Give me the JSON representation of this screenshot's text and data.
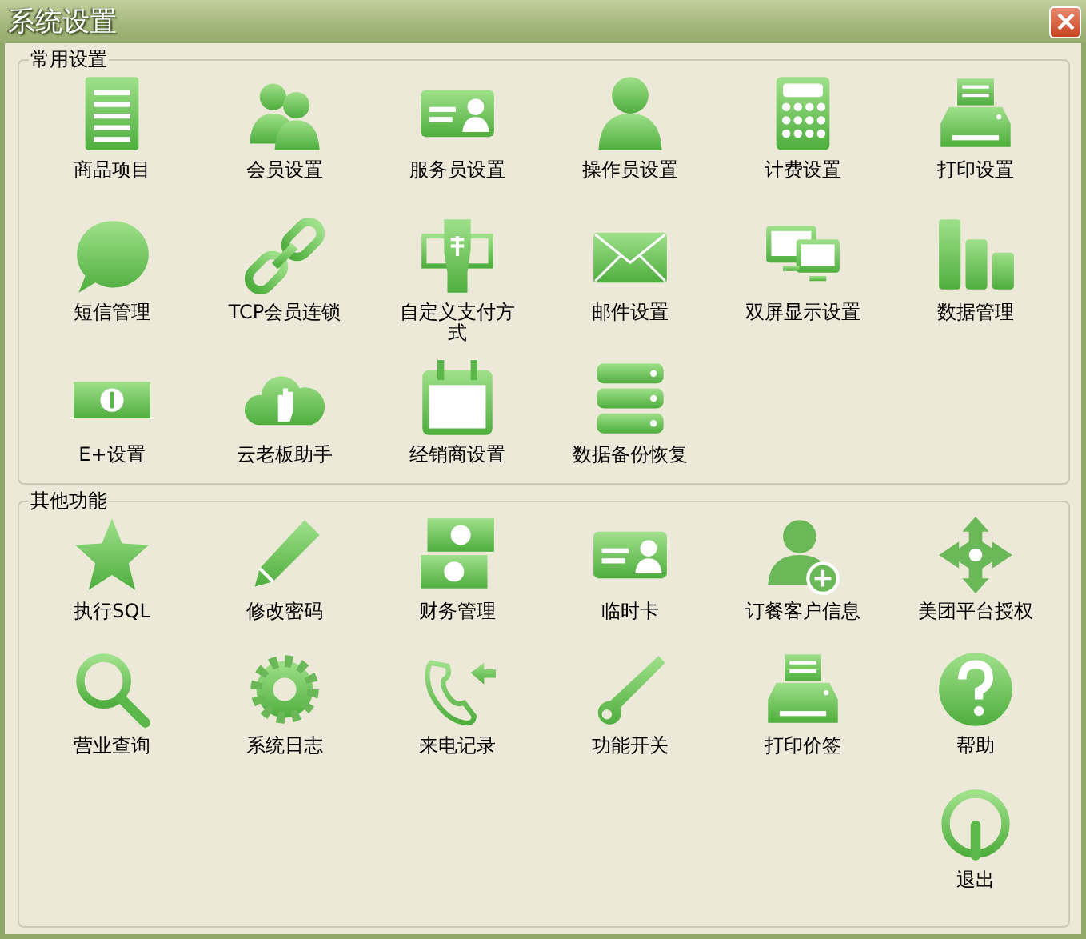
{
  "window": {
    "title": "系统设置"
  },
  "groups": [
    {
      "title": "常用设置",
      "items": [
        {
          "label": "商品项目"
        },
        {
          "label": "会员设置"
        },
        {
          "label": "服务员设置"
        },
        {
          "label": "操作员设置"
        },
        {
          "label": "计费设置"
        },
        {
          "label": "打印设置"
        },
        {
          "label": "短信管理"
        },
        {
          "label": "TCP会员连锁"
        },
        {
          "label": "自定义支付方式"
        },
        {
          "label": "邮件设置"
        },
        {
          "label": "双屏显示设置"
        },
        {
          "label": "数据管理"
        },
        {
          "label": "E+设置"
        },
        {
          "label": "云老板助手"
        },
        {
          "label": "经销商设置"
        },
        {
          "label": "数据备份恢复"
        }
      ]
    },
    {
      "title": "其他功能",
      "items": [
        {
          "label": "执行SQL"
        },
        {
          "label": "修改密码"
        },
        {
          "label": "财务管理"
        },
        {
          "label": "临时卡"
        },
        {
          "label": "订餐客户信息"
        },
        {
          "label": "美团平台授权"
        },
        {
          "label": "营业查询"
        },
        {
          "label": "系统日志"
        },
        {
          "label": "来电记录"
        },
        {
          "label": "功能开关"
        },
        {
          "label": "打印价签"
        },
        {
          "label": "帮助"
        },
        {
          "label": "退出"
        }
      ]
    }
  ]
}
